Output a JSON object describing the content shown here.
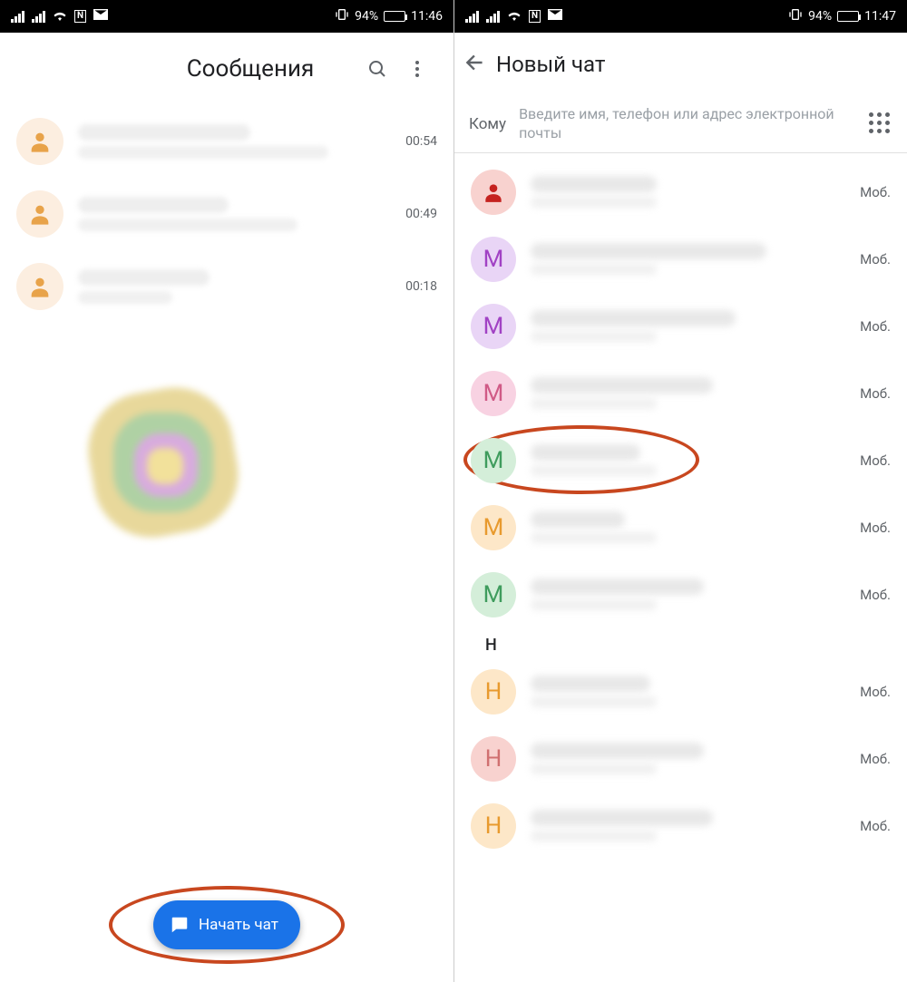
{
  "status": {
    "nfc": "N",
    "mail": "M",
    "vibrate": "}□{",
    "battery_pct": "94%",
    "time_left": "11:46",
    "time_right": "11:47"
  },
  "left": {
    "title": "Сообщения",
    "conversations": [
      {
        "time": "00:54",
        "avatar_bg": "#fceee0",
        "avatar_fg": "#e8a34a"
      },
      {
        "time": "00:49",
        "avatar_bg": "#fceee0",
        "avatar_fg": "#e8a34a"
      },
      {
        "time": "00:18",
        "avatar_bg": "#fceee0",
        "avatar_fg": "#e8a34a"
      }
    ],
    "fab_label": "Начать чат"
  },
  "right": {
    "title": "Новый чат",
    "to_label": "Кому",
    "to_placeholder": "Введите имя, телефон или адрес электронной почты",
    "type_label": "Моб.",
    "section_header": "Н",
    "contacts": [
      {
        "letter": "",
        "bg": "#f8d2cf",
        "fg": "#c5221f",
        "icon": true
      },
      {
        "letter": "M",
        "bg": "#e9d5f6",
        "fg": "#a142c4"
      },
      {
        "letter": "M",
        "bg": "#e9d5f6",
        "fg": "#a142c4"
      },
      {
        "letter": "M",
        "bg": "#f8d2e2",
        "fg": "#d05a86"
      },
      {
        "letter": "M",
        "bg": "#d4eed9",
        "fg": "#3f9c5d",
        "highlight": true
      },
      {
        "letter": "M",
        "bg": "#fde7c8",
        "fg": "#e89a2e"
      },
      {
        "letter": "M",
        "bg": "#d4eed9",
        "fg": "#3f9c5d"
      }
    ],
    "contacts_h": [
      {
        "letter": "Н",
        "bg": "#fde7c8",
        "fg": "#e89a2e"
      },
      {
        "letter": "Н",
        "bg": "#f8d2cf",
        "fg": "#d07070"
      },
      {
        "letter": "Н",
        "bg": "#fde7c8",
        "fg": "#e89a2e"
      }
    ]
  }
}
